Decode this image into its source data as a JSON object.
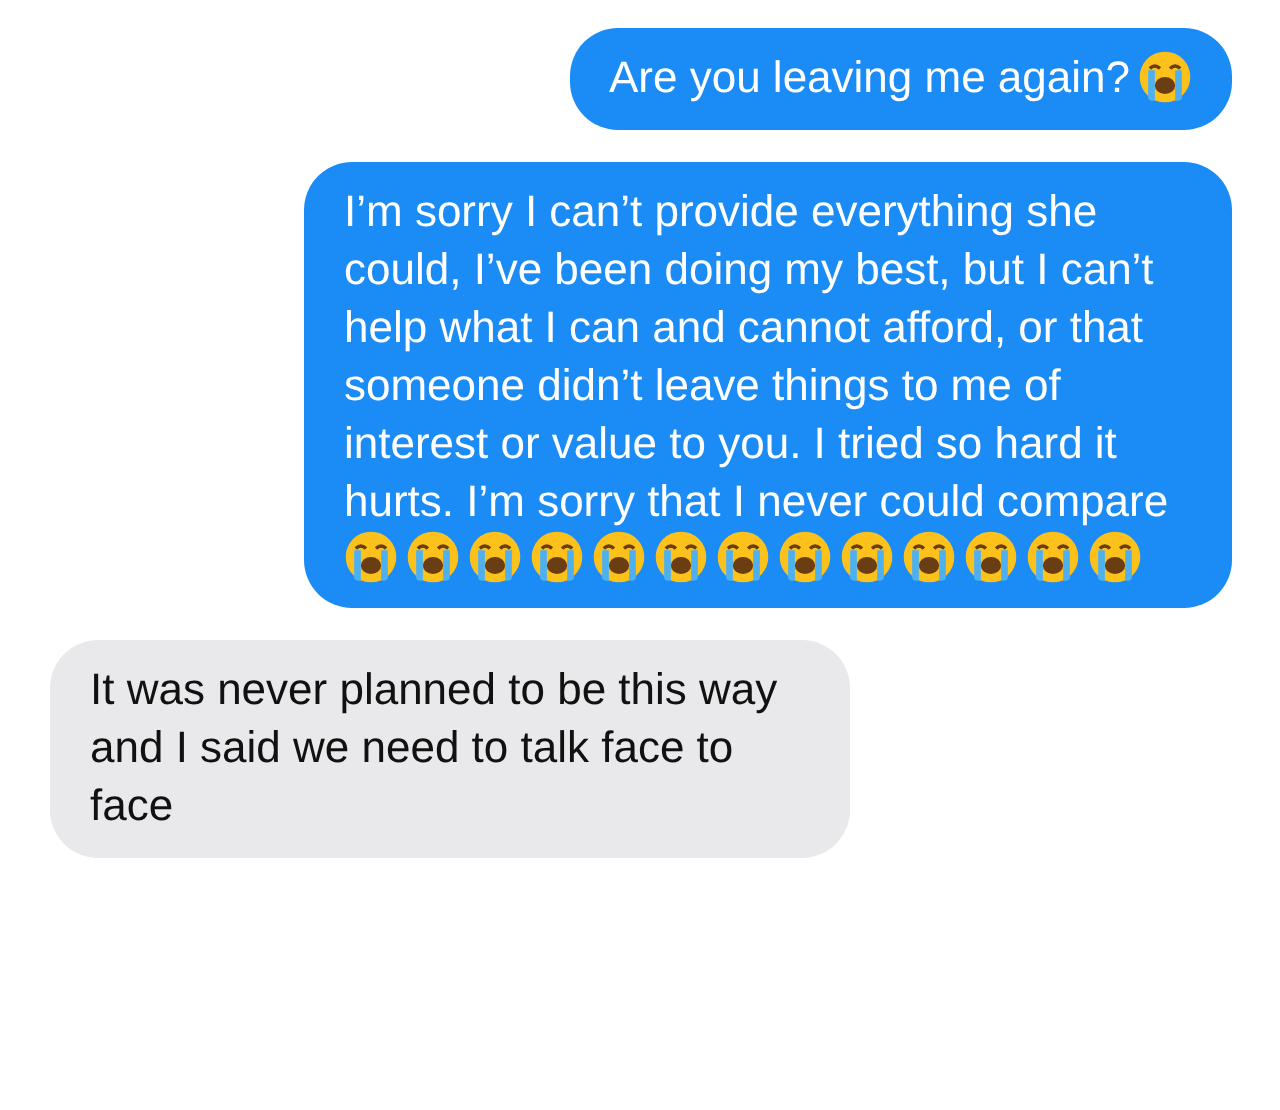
{
  "messages": [
    {
      "outgoing": true,
      "text": "Are you leaving me again?",
      "emojis": [
        {
          "kind": "loudly-crying"
        }
      ]
    },
    {
      "outgoing": true,
      "text": "I’m sorry I can’t provide everything she could, I’ve been doing my best, but I can’t help what I can and cannot afford, or that someone didn’t leave things to me of interest or value to you. I tried so hard it hurts. I’m sorry that I never could compare",
      "emojis": [
        {
          "kind": "loudly-crying"
        },
        {
          "kind": "loudly-crying"
        },
        {
          "kind": "loudly-crying"
        },
        {
          "kind": "loudly-crying"
        },
        {
          "kind": "loudly-crying"
        },
        {
          "kind": "loudly-crying"
        },
        {
          "kind": "loudly-crying"
        },
        {
          "kind": "loudly-crying"
        },
        {
          "kind": "loudly-crying"
        },
        {
          "kind": "loudly-crying"
        },
        {
          "kind": "loudly-crying"
        },
        {
          "kind": "loudly-crying"
        },
        {
          "kind": "loudly-crying"
        }
      ]
    },
    {
      "outgoing": false,
      "text": "It was never planned to be this way and I said we need to talk face to face"
    }
  ]
}
